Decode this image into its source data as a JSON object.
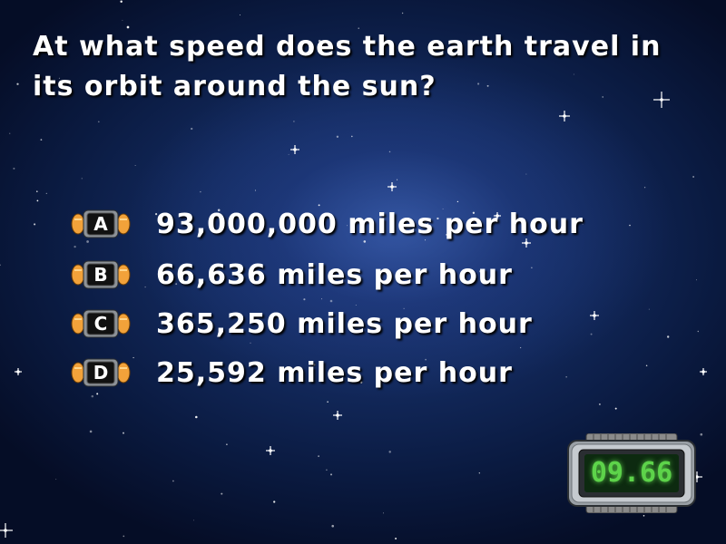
{
  "question": {
    "text": "At what speed does the earth travel in its orbit around the sun?"
  },
  "answers": [
    {
      "letter": "A",
      "text": "93,000,000 miles per hour"
    },
    {
      "letter": "B",
      "text": "66,636 miles per hour"
    },
    {
      "letter": "C",
      "text": "365,250 miles per hour"
    },
    {
      "letter": "D",
      "text": "25,592 miles per hour"
    }
  ],
  "timer": {
    "value": "09.66",
    "digit_color": "#5dd34a"
  },
  "colors": {
    "badge_orange": "#f2a23a",
    "badge_black": "#111111",
    "text": "#ffffff"
  }
}
